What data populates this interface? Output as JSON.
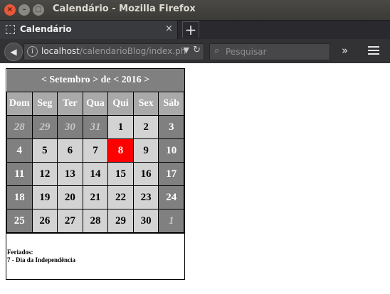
{
  "window": {
    "title": "Calendário - Mozilla Firefox"
  },
  "tab": {
    "label": "Calendário",
    "close": "×",
    "new_tab": "+"
  },
  "nav": {
    "url_host": "localhost",
    "url_path": "/calendarioBlog/index.ph",
    "search_placeholder": "Pesquisar"
  },
  "calendar": {
    "header": {
      "prev_month": "<",
      "month": "Setembro",
      "next_month": ">",
      "de": "de",
      "prev_year": "<",
      "year": "2016",
      "next_year": ">"
    },
    "weekdays": [
      "Dom",
      "Seg",
      "Ter",
      "Qua",
      "Qui",
      "Sex",
      "Sáb"
    ],
    "weeks": [
      [
        {
          "d": "28",
          "t": "other"
        },
        {
          "d": "29",
          "t": "other"
        },
        {
          "d": "30",
          "t": "other"
        },
        {
          "d": "31",
          "t": "other"
        },
        {
          "d": "1",
          "t": "wk"
        },
        {
          "d": "2",
          "t": "wk"
        },
        {
          "d": "3",
          "t": "we"
        }
      ],
      [
        {
          "d": "4",
          "t": "we"
        },
        {
          "d": "5",
          "t": "wk"
        },
        {
          "d": "6",
          "t": "wk"
        },
        {
          "d": "7",
          "t": "wk"
        },
        {
          "d": "8",
          "t": "today"
        },
        {
          "d": "9",
          "t": "wk"
        },
        {
          "d": "10",
          "t": "we"
        }
      ],
      [
        {
          "d": "11",
          "t": "we"
        },
        {
          "d": "12",
          "t": "wk"
        },
        {
          "d": "13",
          "t": "wk"
        },
        {
          "d": "14",
          "t": "wk"
        },
        {
          "d": "15",
          "t": "wk"
        },
        {
          "d": "16",
          "t": "wk"
        },
        {
          "d": "17",
          "t": "we"
        }
      ],
      [
        {
          "d": "18",
          "t": "we"
        },
        {
          "d": "19",
          "t": "wk"
        },
        {
          "d": "20",
          "t": "wk"
        },
        {
          "d": "21",
          "t": "wk"
        },
        {
          "d": "22",
          "t": "wk"
        },
        {
          "d": "23",
          "t": "wk"
        },
        {
          "d": "24",
          "t": "we"
        }
      ],
      [
        {
          "d": "25",
          "t": "we"
        },
        {
          "d": "26",
          "t": "wk"
        },
        {
          "d": "27",
          "t": "wk"
        },
        {
          "d": "28",
          "t": "wk"
        },
        {
          "d": "29",
          "t": "wk"
        },
        {
          "d": "30",
          "t": "wk"
        },
        {
          "d": "1",
          "t": "other"
        }
      ]
    ],
    "holidays": {
      "title": "Feriados:",
      "items": [
        "7 - Dia da Independência"
      ]
    }
  },
  "colors": {
    "today": "#ff0000",
    "weekday_cell": "#d3d3d3",
    "weekend_cell": "#808080",
    "header": "#808080",
    "dow": "#a9a9a9"
  }
}
